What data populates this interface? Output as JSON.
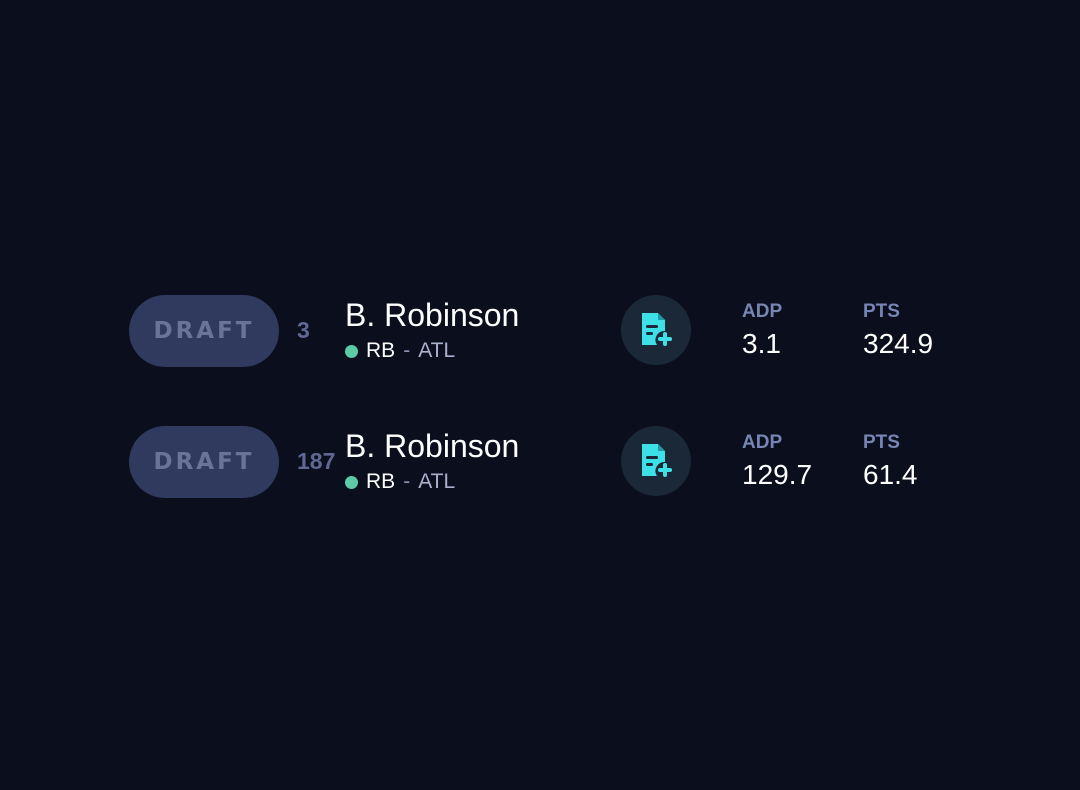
{
  "players": [
    {
      "draft_label": "DRAFT",
      "rank": "3",
      "name": "B. Robinson",
      "position": "RB",
      "separator": "-",
      "team": "ATL",
      "adp_label": "ADP",
      "adp_value": "3.1",
      "pts_label": "PTS",
      "pts_value": "324.9"
    },
    {
      "draft_label": "DRAFT",
      "rank": "187",
      "name": "B. Robinson",
      "position": "RB",
      "separator": "-",
      "team": "ATL",
      "adp_label": "ADP",
      "adp_value": "129.7",
      "pts_label": "PTS",
      "pts_value": "61.4"
    }
  ],
  "icons": {
    "note": "add-note-icon",
    "position_dot": "position-status-dot"
  },
  "colors": {
    "background": "#0b0e1c",
    "draft_button": "#2f3a5e",
    "accent_cyan": "#3ee0e8",
    "position_dot": "#5cc9a9",
    "stat_label": "#7785b4"
  }
}
